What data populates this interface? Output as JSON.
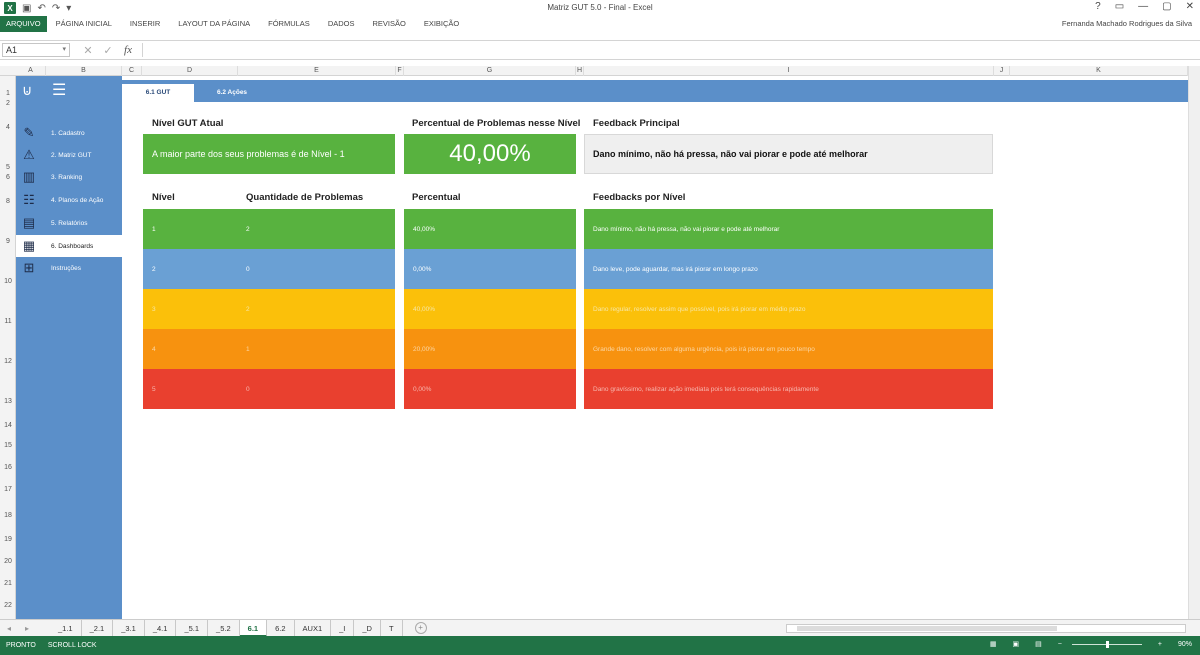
{
  "app": {
    "title": "Matriz GUT 5.0 - Final - Excel",
    "user": "Fernanda Machado Rodrigues da Silva",
    "ribbon_tabs": [
      "ARQUIVO",
      "PÁGINA INICIAL",
      "INSERIR",
      "LAYOUT DA PÁGINA",
      "FÓRMULAS",
      "DADOS",
      "REVISÃO",
      "EXIBIÇÃO"
    ],
    "window_controls": [
      "?",
      "▭",
      "—",
      "▢",
      "✕"
    ]
  },
  "formula_bar": {
    "name_box": "A1",
    "cancel": "✕",
    "enter": "✓",
    "fx": "fx",
    "value": ""
  },
  "columns": [
    "A",
    "B",
    "C",
    "D",
    "E",
    "F",
    "G",
    "H",
    "I",
    "J",
    "K"
  ],
  "rows": [
    "1",
    "2",
    "4",
    "5",
    "6",
    "8",
    "9",
    "10",
    "11",
    "12",
    "13",
    "14",
    "15",
    "16",
    "17",
    "18",
    "19",
    "20",
    "21",
    "22"
  ],
  "sidebar": {
    "items": [
      {
        "label": "1. Cadastro",
        "icon": "document-edit-icon"
      },
      {
        "label": "2. Matriz GUT",
        "icon": "alarm-icon"
      },
      {
        "label": "3. Ranking",
        "icon": "buildings-icon"
      },
      {
        "label": "4. Planos de Ação",
        "icon": "checklist-icon"
      },
      {
        "label": "5. Relatórios",
        "icon": "report-icon"
      },
      {
        "label": "6. Dashboards",
        "icon": "chart-icon",
        "active": true
      },
      {
        "label": "Instruções",
        "icon": "help-icon"
      }
    ]
  },
  "tabs": [
    {
      "label": "6.1 GUT",
      "active": true
    },
    {
      "label": "6.2 Ações",
      "active": false
    }
  ],
  "dashboard": {
    "nivel_header": "Nível GUT Atual",
    "nivel_text": "A maior parte dos seus problemas é de Nível - 1",
    "percent_header": "Percentual de Problemas nesse Nível",
    "percent_value": "40,00%",
    "feedback_header": "Feedback Principal",
    "feedback_text": "Dano mínimo, não há pressa, não vai piorar e pode até melhorar",
    "table_headers": {
      "nivel": "Nível",
      "quantidade": "Quantidade de Problemas",
      "percentual": "Percentual",
      "feedbacks": "Feedbacks por Nível"
    },
    "levels": [
      {
        "nivel": "1",
        "quantidade": "2",
        "percentual": "40,00%",
        "feedback": "Dano mínimo, não há pressa, não vai piorar e pode até melhorar",
        "color": "#58b23f",
        "text_color": "#ffffff"
      },
      {
        "nivel": "2",
        "quantidade": "0",
        "percentual": "0,00%",
        "feedback": "Dano leve, pode aguardar, mas irá piorar em longo prazo",
        "color": "#6aa0d4",
        "text_color": "#ffffff"
      },
      {
        "nivel": "3",
        "quantidade": "2",
        "percentual": "40,00%",
        "feedback": "Dano regular, resolver assim que possível, pois irá piorar em médio prazo",
        "color": "#fbc00a",
        "text_color": "#f7e6a6"
      },
      {
        "nivel": "4",
        "quantidade": "1",
        "percentual": "20,00%",
        "feedback": "Grande dano, resolver com alguma urgência, pois irá piorar em pouco tempo",
        "color": "#f7920f",
        "text_color": "#fbd7a6"
      },
      {
        "nivel": "5",
        "quantidade": "0",
        "percentual": "0,00%",
        "feedback": "Dano gravíssimo, realizar ação imediata pois terá consequências rapidamente",
        "color": "#e9402f",
        "text_color": "#f7b7ae"
      }
    ]
  },
  "sheet_tabs": [
    "_1.1",
    "_2.1",
    "_3.1",
    "_4.1",
    "_5.1",
    "_5.2",
    "6.1",
    "6.2",
    "AUX1",
    "_I",
    "_D",
    "T"
  ],
  "active_sheet": "6.1",
  "status": {
    "left": [
      "PRONTO",
      "SCROLL LOCK"
    ],
    "zoom": "90%"
  }
}
